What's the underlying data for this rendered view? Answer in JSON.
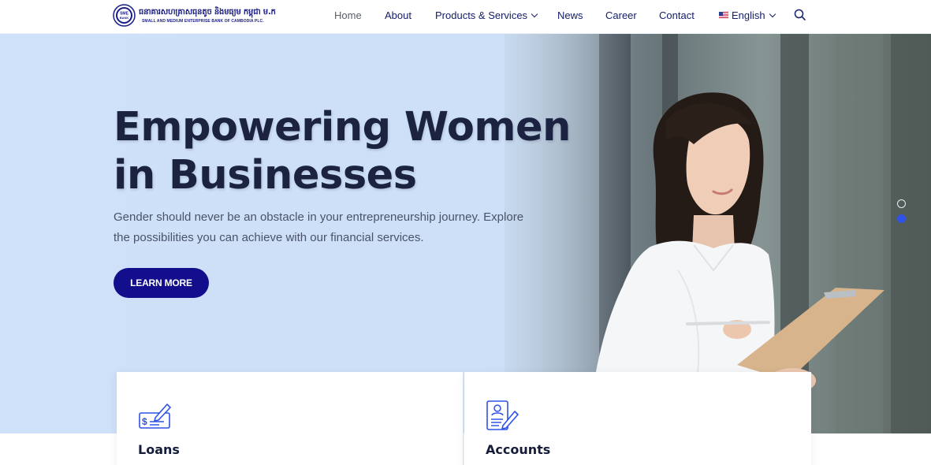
{
  "brand": {
    "name_km": "ធនាគារសហគ្រាសធុនតូច និងមធ្យម កម្ពុជា ម.ក",
    "name_en": "SMALL AND MEDIUM ENTERPRISE BANK OF CAMBODIA PLC.",
    "seal_text": "SME BANK",
    "color": "#1a1e86"
  },
  "nav": {
    "items": [
      {
        "label": "Home",
        "active": true
      },
      {
        "label": "About"
      },
      {
        "label": "Products & Services",
        "dropdown": true
      },
      {
        "label": "News"
      },
      {
        "label": "Career"
      },
      {
        "label": "Contact"
      }
    ],
    "language": {
      "label": "English",
      "flag": "us-flag-icon"
    },
    "search_icon": "search-icon"
  },
  "hero": {
    "title_line1": "Empowering Women",
    "title_line2": "in Businesses",
    "text": "Gender should never be an obstacle in your entrepreneurship journey. Explore the possibilities you can achieve with our financial services.",
    "button": "LEARN MORE",
    "button_color": "#120e8c",
    "slides": 2,
    "active_slide": 2
  },
  "cards": [
    {
      "title": "Loans",
      "icon": "cheque-icon"
    },
    {
      "title": "Accounts",
      "icon": "account-document-icon"
    }
  ]
}
